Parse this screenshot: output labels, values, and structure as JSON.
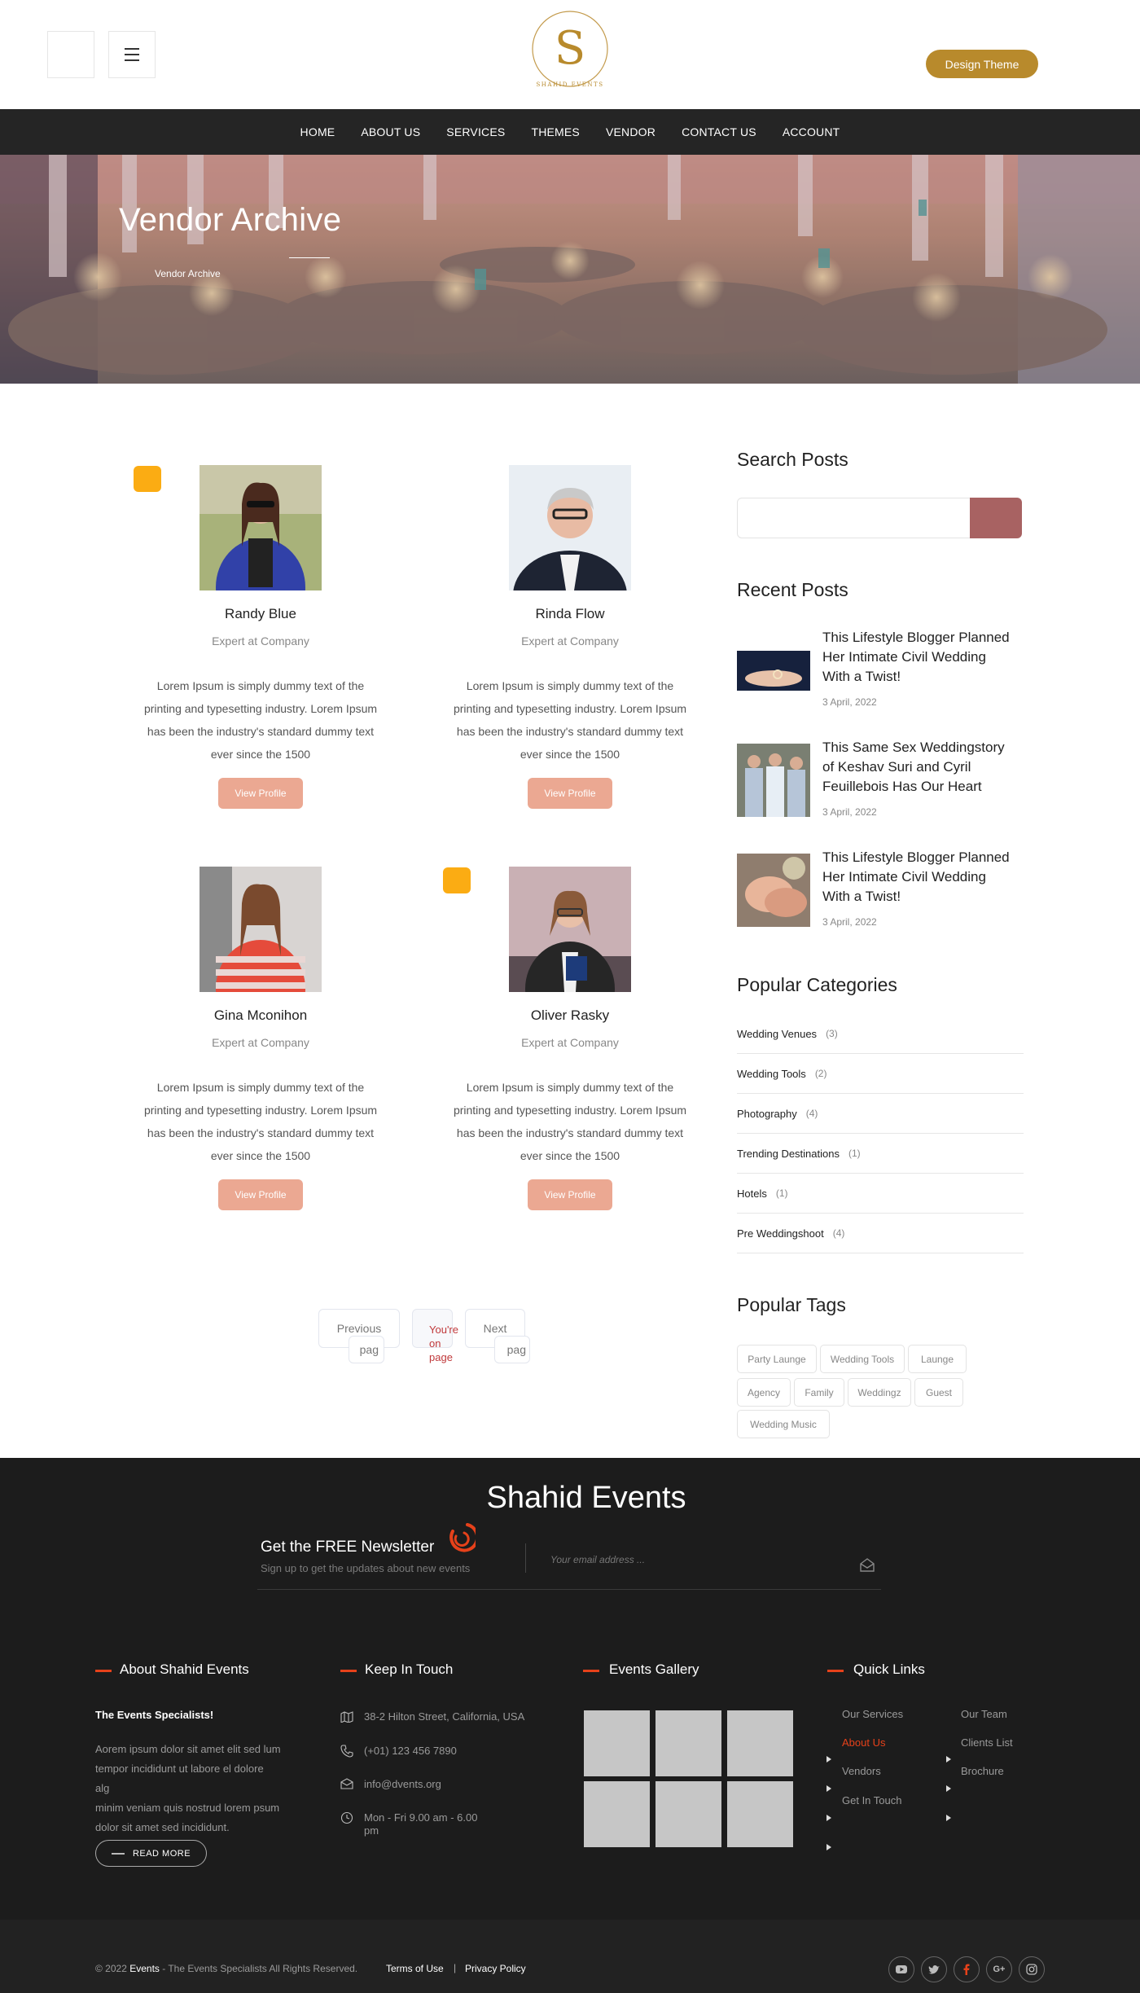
{
  "header": {
    "design_button": "Design Theme",
    "logo_letter": "S",
    "logo_text": "SHAHID EVENTS"
  },
  "nav": [
    "HOME",
    "ABOUT US",
    "SERVICES",
    "THEMES",
    "VENDOR",
    "CONTACT US",
    "ACCOUNT"
  ],
  "hero": {
    "title": "Vendor Archive",
    "breadcrumb": "Vendor Archive"
  },
  "vendors": [
    {
      "name": "Randy Blue",
      "role": "Expert at Company",
      "desc": [
        "Lorem Ipsum is simply dummy text of the",
        "printing and typesetting industry. Lorem Ipsum",
        "has been the industry's standard dummy text",
        "ever since the 1500"
      ],
      "button": "View Profile"
    },
    {
      "name": "Rinda Flow",
      "role": "Expert at Company",
      "desc": [
        "Lorem Ipsum is simply dummy text of the",
        "printing and typesetting industry. Lorem Ipsum",
        "has been the industry's standard dummy text",
        "ever since the 1500"
      ],
      "button": "View Profile"
    },
    {
      "name": "Gina Mconihon",
      "role": "Expert at Company",
      "desc": [
        "Lorem Ipsum is simply dummy text of the",
        "printing and typesetting industry. Lorem Ipsum",
        "has been the industry's standard dummy text",
        "ever since the 1500"
      ],
      "button": "View Profile"
    },
    {
      "name": "Oliver Rasky",
      "role": "Expert at Company",
      "desc": [
        "Lorem Ipsum is simply dummy text of the",
        "printing and typesetting industry. Lorem Ipsum",
        "has been the industry's standard dummy text",
        "ever since the 1500"
      ],
      "button": "View Profile"
    }
  ],
  "pagination": {
    "previous": "Previous",
    "current_lines": [
      "You're",
      "on",
      "page"
    ],
    "next": "Next",
    "pag": "pag"
  },
  "sidebar": {
    "search_title": "Search Posts",
    "recent_title": "Recent Posts",
    "recent": [
      {
        "title_lines": [
          "This Lifestyle Blogger Planned",
          "Her Intimate Civil Wedding",
          "With a Twist!"
        ],
        "date": "3 April, 2022"
      },
      {
        "title_lines": [
          "This Same Sex Weddingstory",
          "of Keshav Suri and Cyril",
          "Feuillebois Has Our Heart"
        ],
        "date": "3 April, 2022"
      },
      {
        "title_lines": [
          "This Lifestyle Blogger Planned",
          "Her Intimate Civil Wedding",
          "With a Twist!"
        ],
        "date": "3 April, 2022"
      }
    ],
    "categories_title": "Popular Categories",
    "categories": [
      {
        "name": "Wedding Venues",
        "count": "(3)"
      },
      {
        "name": "Wedding Tools",
        "count": "(2)"
      },
      {
        "name": "Photography",
        "count": "(4)"
      },
      {
        "name": "Trending Destinations",
        "count": "(1)"
      },
      {
        "name": "Hotels",
        "count": "(1)"
      },
      {
        "name": "Pre Weddingshoot",
        "count": "(4)"
      }
    ],
    "tags_title": "Popular Tags",
    "tags": [
      "Party Launge",
      "Wedding Tools",
      "Launge",
      "Agency",
      "Family",
      "Weddingz",
      "Guest",
      "Wedding Music"
    ]
  },
  "footer": {
    "brand": "Shahid Events",
    "newsletter_title": "Get the FREE Newsletter",
    "newsletter_sub": "Sign up to get the updates about new events",
    "email_placeholder": "Your email address ...",
    "about_title": "About Shahid Events",
    "about_subtitle": "The Events Specialists!",
    "about_text": [
      "Aorem ipsum dolor sit amet elit sed lum",
      "tempor incididunt ut labore el dolore",
      "alg",
      "minim veniam quis nostrud lorem psum",
      "dolor sit amet sed incididunt."
    ],
    "read_more": "READ MORE",
    "touch_title": "Keep In Touch",
    "address": "38-2 Hilton Street, California, USA",
    "phone": "(+01) 123 456 7890",
    "email": "info@dvents.org",
    "hours": [
      "Mon - Fri 9.00 am - 6.00",
      "pm"
    ],
    "gallery_title": "Events Gallery",
    "links_title": "Quick Links",
    "links_col1": [
      "Our Services",
      "About Us",
      "Vendors",
      "Get In Touch"
    ],
    "links_col2": [
      "Our Team",
      "Clients List",
      "Brochure"
    ],
    "copyright_pre": "© 2022 ",
    "copyright_brand": "Events",
    "copyright_post": " - The Events Specialists All Rights Reserved.",
    "terms": "Terms of Use",
    "separator": "|",
    "privacy": "Privacy Policy"
  },
  "colors": {
    "accent": "#b88a2c",
    "nav_bg": "#252525",
    "button": "#eba892",
    "badge": "#fbac13",
    "search_btn": "#a86262",
    "footer_bg": "#1c1c1c",
    "footer_accent": "#e6411a"
  }
}
